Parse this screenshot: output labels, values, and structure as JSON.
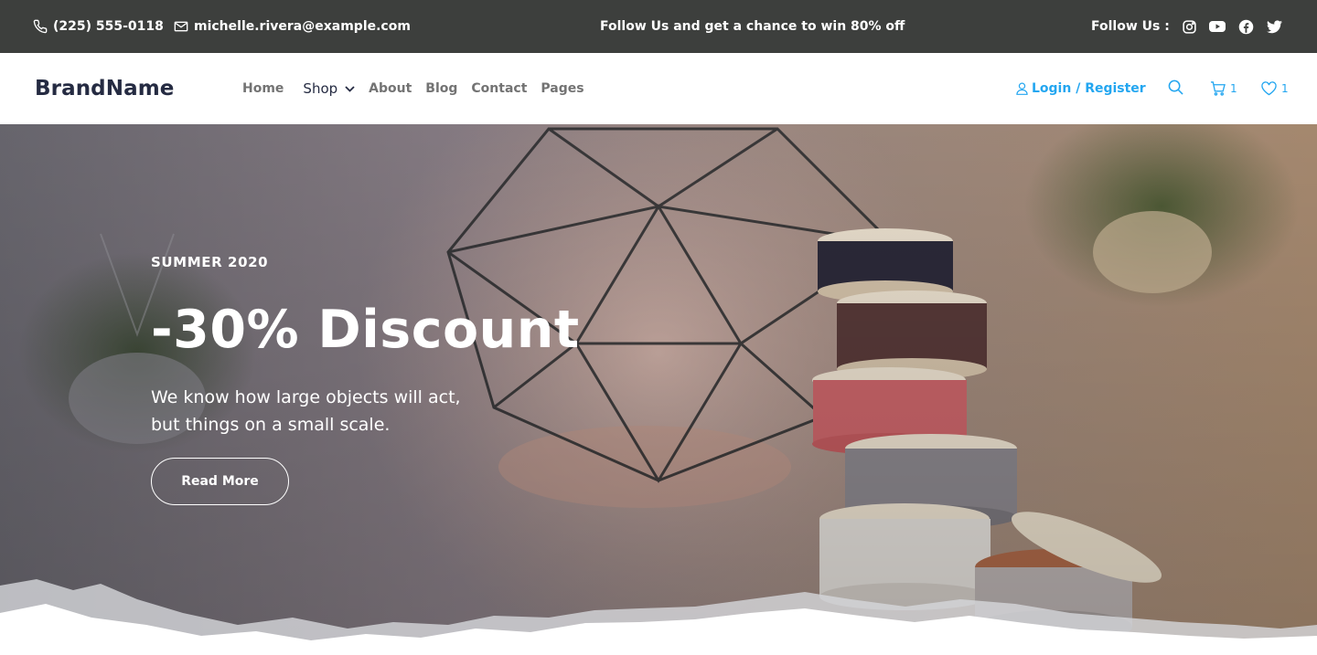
{
  "topbar": {
    "phone": "(225) 555-0118",
    "email": "michelle.rivera@example.com",
    "promo": "Follow Us  and get a chance to win 80% off",
    "follow_label": "Follow Us :",
    "social": [
      "instagram-icon",
      "youtube-icon",
      "facebook-icon",
      "twitter-icon"
    ],
    "bg_color": "#3d3f3d"
  },
  "nav": {
    "brand": "BrandName",
    "menu": [
      {
        "label": "Home"
      },
      {
        "label": "Shop",
        "has_dropdown": true
      },
      {
        "label": "About"
      },
      {
        "label": "Blog"
      },
      {
        "label": "Contact"
      },
      {
        "label": "Pages"
      }
    ],
    "login_label": "Login / Register",
    "cart_count": "1",
    "wishlist_count": "1",
    "accent_color": "#23a6f0",
    "brand_color": "#252b42",
    "menu_color": "#737373"
  },
  "hero": {
    "season": "SUMMER 2020",
    "headline": "-30% Discount",
    "subtitle_line1": "We know how large objects will act,",
    "subtitle_line2": "but things on a small scale.",
    "button_label": "Read More"
  }
}
